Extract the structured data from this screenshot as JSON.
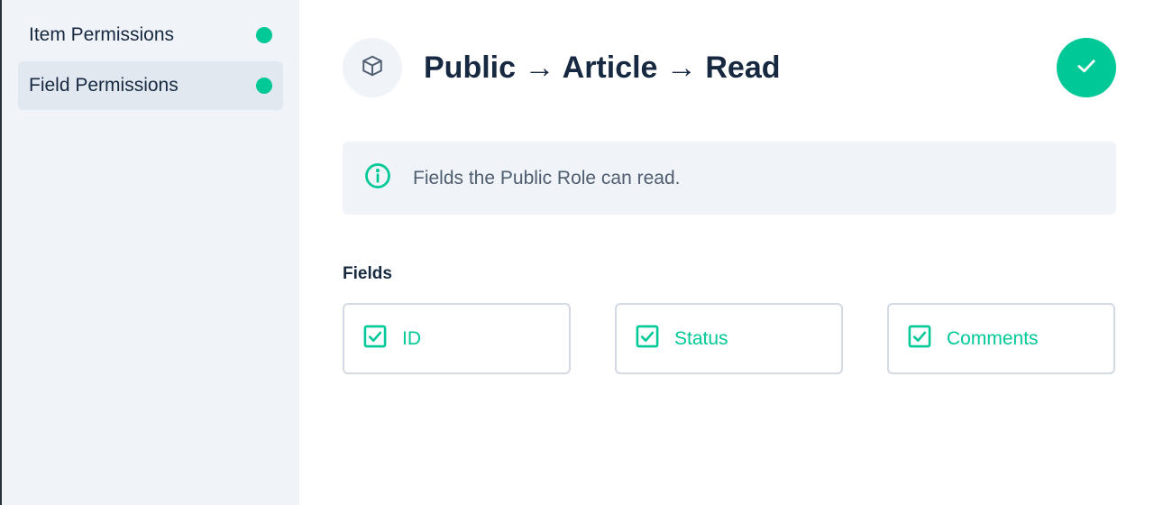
{
  "sidebar": {
    "items": [
      {
        "label": "Item Permissions",
        "status_color": "#00c897",
        "active": false
      },
      {
        "label": "Field Permissions",
        "status_color": "#00c897",
        "active": true
      }
    ]
  },
  "header": {
    "icon": "box-icon",
    "title": "Public → Article → Read",
    "confirm_icon": "check-icon"
  },
  "notice": {
    "icon": "info-icon",
    "text": "Fields the Public Role can read."
  },
  "fields": {
    "label": "Fields",
    "items": [
      {
        "label": "ID",
        "checked": true
      },
      {
        "label": "Status",
        "checked": true
      },
      {
        "label": "Comments",
        "checked": true
      }
    ]
  },
  "colors": {
    "accent": "#00c897",
    "sidebar_bg": "#f0f4f9",
    "active_item_bg": "#e1e8f0",
    "title": "#172940"
  }
}
